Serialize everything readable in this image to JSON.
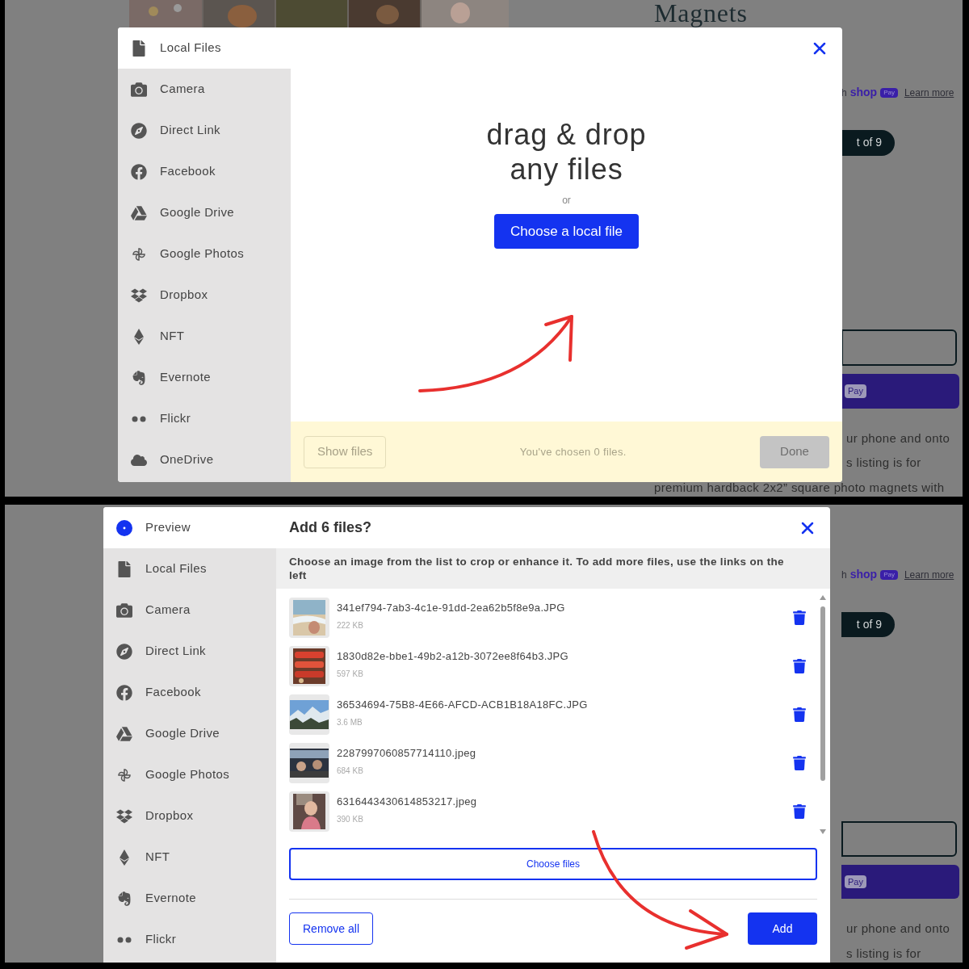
{
  "local_files_screen": {
    "page": {
      "heading": "Magnets",
      "shop_prefix": "h",
      "shop_logo": "shop",
      "shop_badge": "Pay",
      "learn_more": "Learn more",
      "counter": "t of 9",
      "pay_badge": "Pay",
      "description_lines": [
        "ur phone and onto",
        "s listing is for",
        "premium hardback 2x2” square photo magnets with"
      ]
    },
    "modal": {
      "sources": [
        {
          "label": "Local Files",
          "kind": "file",
          "selected": true
        },
        {
          "label": "Camera",
          "kind": "camera",
          "selected": false
        },
        {
          "label": "Direct Link",
          "kind": "compass",
          "selected": false
        },
        {
          "label": "Facebook",
          "kind": "facebook",
          "selected": false
        },
        {
          "label": "Google Drive",
          "kind": "drive",
          "selected": false
        },
        {
          "label": "Google Photos",
          "kind": "pinwheel",
          "selected": false
        },
        {
          "label": "Dropbox",
          "kind": "dropbox",
          "selected": false
        },
        {
          "label": "NFT",
          "kind": "diamond",
          "selected": false
        },
        {
          "label": "Evernote",
          "kind": "elephant",
          "selected": false
        },
        {
          "label": "Flickr",
          "kind": "dots",
          "selected": false
        },
        {
          "label": "OneDrive",
          "kind": "cloud",
          "selected": false
        }
      ],
      "dropzone": {
        "title_lines": [
          "drag & drop",
          "any files"
        ],
        "or": "or",
        "button": "Choose a local file"
      },
      "footer": {
        "show_files": "Show files",
        "status": "You've chosen 0 files.",
        "done": "Done",
        "disabled": true
      }
    }
  },
  "preview_screen": {
    "page": {
      "shop_prefix": "h",
      "shop_logo": "shop",
      "shop_badge": "Pay",
      "learn_more": "Learn more",
      "counter": "t of 9",
      "pay_badge": "Pay",
      "description_lines": [
        "ur phone and onto",
        "s listing is for"
      ]
    },
    "modal": {
      "sources": [
        {
          "label": "Preview",
          "kind": "preview",
          "selected": true
        },
        {
          "label": "Local Files",
          "kind": "file",
          "selected": false
        },
        {
          "label": "Camera",
          "kind": "camera",
          "selected": false
        },
        {
          "label": "Direct Link",
          "kind": "compass",
          "selected": false
        },
        {
          "label": "Facebook",
          "kind": "facebook",
          "selected": false
        },
        {
          "label": "Google Drive",
          "kind": "drive",
          "selected": false
        },
        {
          "label": "Google Photos",
          "kind": "pinwheel",
          "selected": false
        },
        {
          "label": "Dropbox",
          "kind": "dropbox",
          "selected": false
        },
        {
          "label": "NFT",
          "kind": "diamond",
          "selected": false
        },
        {
          "label": "Evernote",
          "kind": "elephant",
          "selected": false
        },
        {
          "label": "Flickr",
          "kind": "dots",
          "selected": false
        }
      ],
      "title": "Add 6 files?",
      "instructions": "Choose an image from the list to crop or enhance it. To add more files, use the links on the left",
      "files": [
        {
          "name": "341ef794-7ab3-4c1e-91dd-2ea62b5f8e9a.JPG",
          "size": "222 KB"
        },
        {
          "name": "1830d82e-bbe1-49b2-a12b-3072ee8f64b3.JPG",
          "size": "597 KB"
        },
        {
          "name": "36534694-75B8-4E66-AFCD-ACB1B18A18FC.JPG",
          "size": "3.6 MB"
        },
        {
          "name": "2287997060857714110.jpeg",
          "size": "684 KB"
        },
        {
          "name": "6316443430614853217.jpeg",
          "size": "390 KB"
        }
      ],
      "choose_files": "Choose files",
      "remove_all": "Remove all",
      "add": "Add"
    }
  }
}
